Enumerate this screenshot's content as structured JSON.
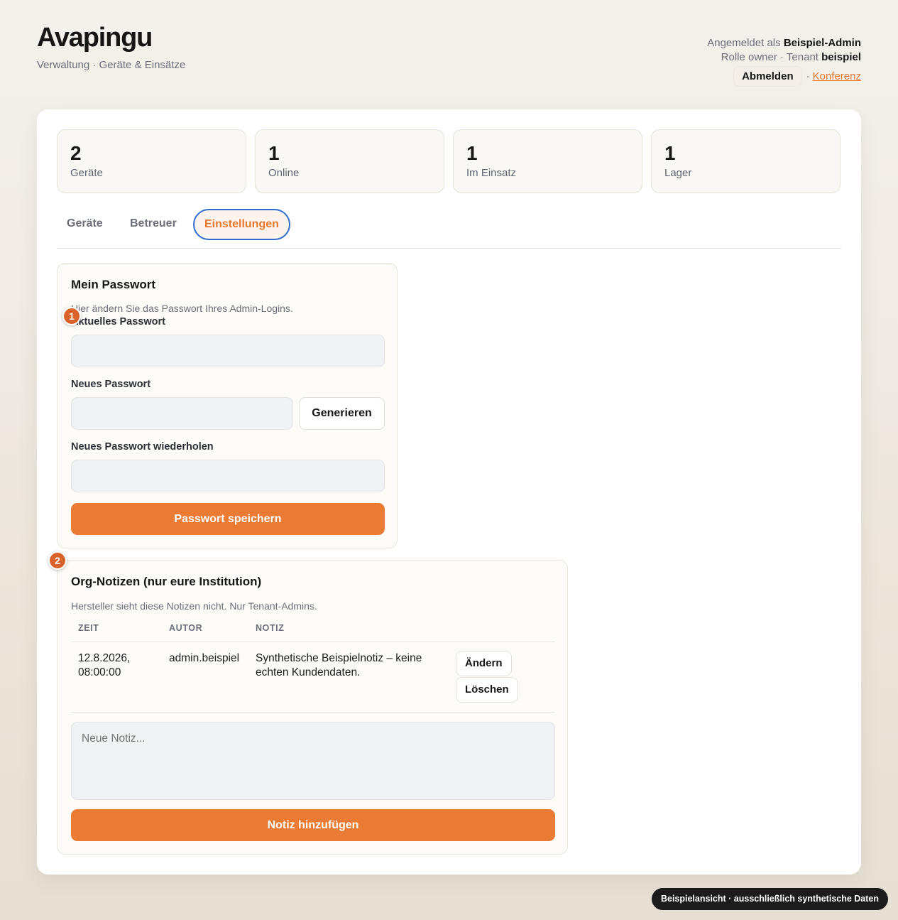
{
  "header": {
    "brand": "Avapingu",
    "subtitle": "Verwaltung · Geräte & Einsätze",
    "logged_in_prefix": "Angemeldet als",
    "user_name": "Beispiel-Admin",
    "role_line_prefix": "Rolle owner · Tenant",
    "tenant": "beispiel",
    "logout_label": "Abmelden",
    "separator": "·",
    "conference_link": "Konferenz"
  },
  "stats": [
    {
      "value": "2",
      "label": "Geräte"
    },
    {
      "value": "1",
      "label": "Online"
    },
    {
      "value": "1",
      "label": "Im Einsatz"
    },
    {
      "value": "1",
      "label": "Lager"
    }
  ],
  "tabs": [
    {
      "label": "Geräte",
      "active": false
    },
    {
      "label": "Betreuer",
      "active": false
    },
    {
      "label": "Einstellungen",
      "active": true
    }
  ],
  "password_panel": {
    "marker": "1",
    "title": "Mein Passwort",
    "description": "Hier ändern Sie das Passwort Ihres Admin-Logins.",
    "current_label": "Aktuelles Passwort",
    "new_label": "Neues Passwort",
    "generate_label": "Generieren",
    "repeat_label": "Neues Passwort wiederholen",
    "save_label": "Passwort speichern"
  },
  "notes_panel": {
    "marker": "2",
    "title": "Org-Notizen (nur eure Institution)",
    "description": "Hersteller sieht diese Notizen nicht. Nur Tenant-Admins.",
    "columns": [
      "ZEIT",
      "AUTOR",
      "NOTIZ"
    ],
    "rows": [
      {
        "time_line1": "12.8.2026,",
        "time_line2": "08:00:00",
        "author": "admin.beispiel",
        "note_line1": "Synthetische Beispielnotiz – keine",
        "note_line2": "echten Kundendaten.",
        "edit_label": "Ändern",
        "delete_label": "Löschen"
      }
    ],
    "new_note_placeholder": "Neue Notiz...",
    "add_label": "Notiz hinzufügen"
  },
  "footer_badge": "Beispielansicht · ausschließlich synthetische Daten",
  "colors": {
    "accent": "#e97b35",
    "focus_ring": "#2f6fd1",
    "marker": "#d9622a"
  }
}
